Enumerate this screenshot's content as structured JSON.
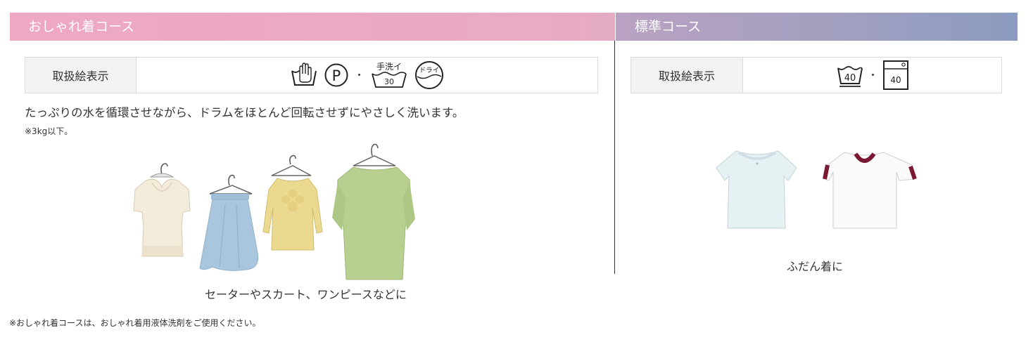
{
  "colors": {
    "oshare_header": "#eea8c3",
    "standard_header_start": "#b9a1c3",
    "standard_header_end": "#8b9cc0",
    "label_bg": "#f2f2f2"
  },
  "oshare": {
    "title": "おしゃれ着コース",
    "care_label": "取扱絵表示",
    "symbols": {
      "hand_wash_icon": "hand-wash-tub-icon",
      "dry_clean_letter": "P",
      "separator": "・",
      "hand_wash_text": "手洗イ",
      "hand_wash_temp": "30",
      "dry_text": "ドライ"
    },
    "description": "たっぷりの水を循環させながら、ドラムをほとんど回転させずにやさしく洗います。",
    "weight_note": "※3kg以下。",
    "garments": [
      "sweater-image",
      "skirt-image",
      "blouse-image",
      "dress-image"
    ],
    "caption": "セーターやスカート、ワンピースなどに"
  },
  "standard": {
    "title": "標準コース",
    "care_label": "取扱絵表示",
    "symbols": {
      "wash_temp": "40",
      "separator": "・",
      "machine_temp": "40"
    },
    "garments": [
      "white-tshirt-image",
      "ringer-tshirt-image"
    ],
    "caption": "ふだん着に"
  },
  "footer_note": "※おしゃれ着コースは、おしゃれ着用液体洗剤をご使用ください。"
}
